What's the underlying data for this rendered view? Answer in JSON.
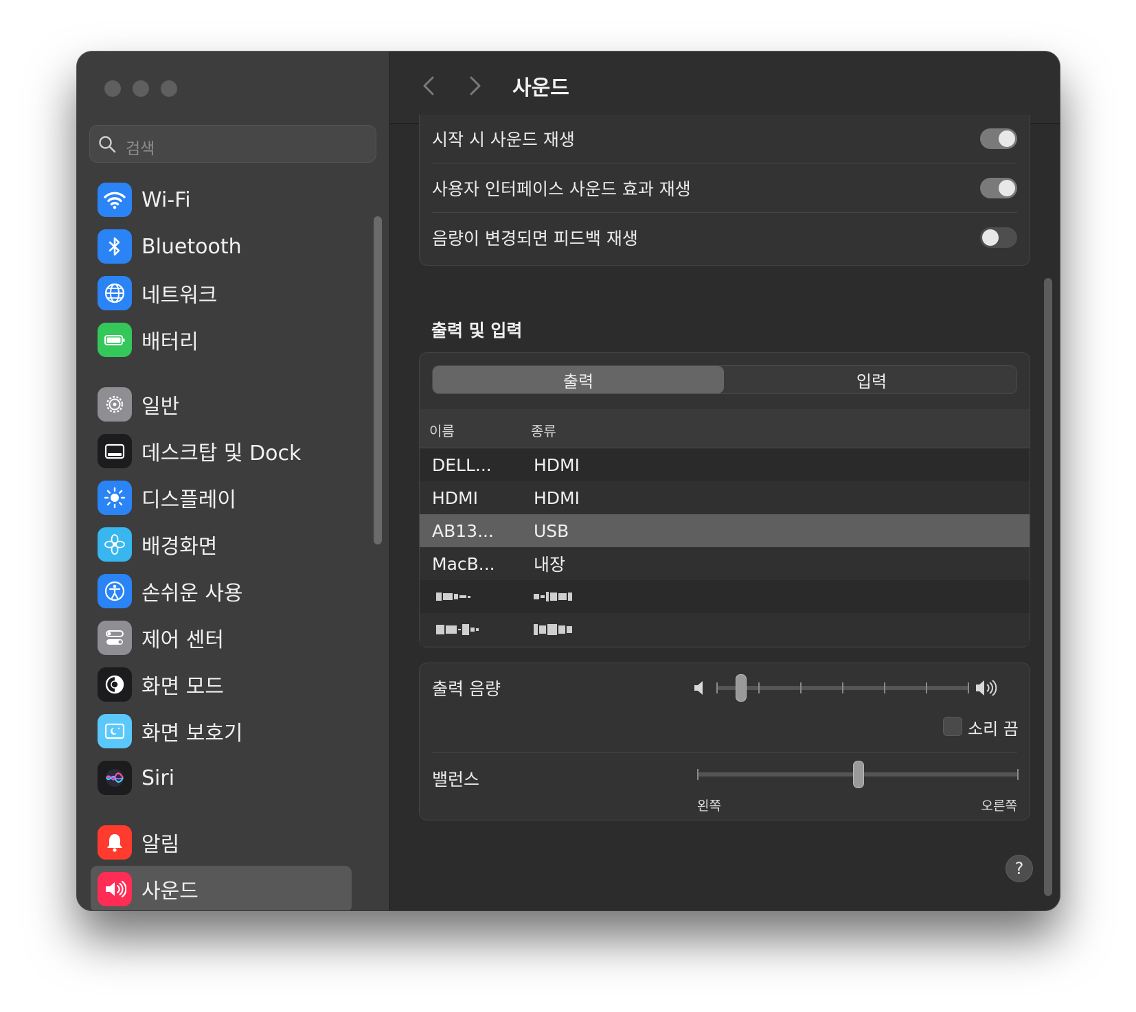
{
  "window": {
    "title": "사운드"
  },
  "sidebar": {
    "search_placeholder": "검색",
    "items": [
      {
        "label": "Wi-Fi",
        "icon": "wifi-icon",
        "color": "#2a84f6"
      },
      {
        "label": "Bluetooth",
        "icon": "bluetooth-icon",
        "color": "#2a84f6"
      },
      {
        "label": "네트워크",
        "icon": "globe-icon",
        "color": "#2a84f6"
      },
      {
        "label": "배터리",
        "icon": "battery-icon",
        "color": "#34c759"
      },
      {
        "label": "일반",
        "icon": "gear-icon",
        "color": "#8e8e93"
      },
      {
        "label": "데스크탑 및 Dock",
        "icon": "dock-icon",
        "color": "#1c1c1e"
      },
      {
        "label": "디스플레이",
        "icon": "sun-icon",
        "color": "#2a84f6"
      },
      {
        "label": "배경화면",
        "icon": "flower-icon",
        "color": "#38b6f0"
      },
      {
        "label": "손쉬운 사용",
        "icon": "accessibility-icon",
        "color": "#2a84f6"
      },
      {
        "label": "제어 센터",
        "icon": "control-center-icon",
        "color": "#8e8e93"
      },
      {
        "label": "화면 모드",
        "icon": "appearance-icon",
        "color": "#1c1c1e"
      },
      {
        "label": "화면 보호기",
        "icon": "screensaver-icon",
        "color": "#5ac8fa"
      },
      {
        "label": "Siri",
        "icon": "siri-icon",
        "color": "#1c1c1e"
      },
      {
        "label": "알림",
        "icon": "bell-icon",
        "color": "#ff3b30"
      },
      {
        "label": "사운드",
        "icon": "speaker-icon",
        "color": "#ff2d55",
        "selected": true
      }
    ]
  },
  "sound_effects": {
    "rows": [
      {
        "label": "시작 시 사운드 재생",
        "on": true
      },
      {
        "label": "사용자 인터페이스 사운드 효과 재생",
        "on": true
      },
      {
        "label": "음량이 변경되면 피드백 재생",
        "on": false
      }
    ]
  },
  "output_input": {
    "section_title": "출력 및 입력",
    "tabs": [
      "출력",
      "입력"
    ],
    "active_tab": "출력",
    "columns": [
      "이름",
      "종류"
    ],
    "devices": [
      {
        "name": "DELL...",
        "type": "HDMI"
      },
      {
        "name": "HDMI",
        "type": "HDMI"
      },
      {
        "name": "AB13...",
        "type": "USB",
        "selected": true
      },
      {
        "name": "MacB...",
        "type": "내장"
      }
    ]
  },
  "volume": {
    "label": "출력 음량",
    "level": 0.08,
    "mute_label": "소리 끔",
    "muted": false
  },
  "balance": {
    "label": "밸런스",
    "value": 0.5,
    "left_label": "왼쪽",
    "right_label": "오른쪽"
  },
  "help": {
    "label": "?"
  }
}
